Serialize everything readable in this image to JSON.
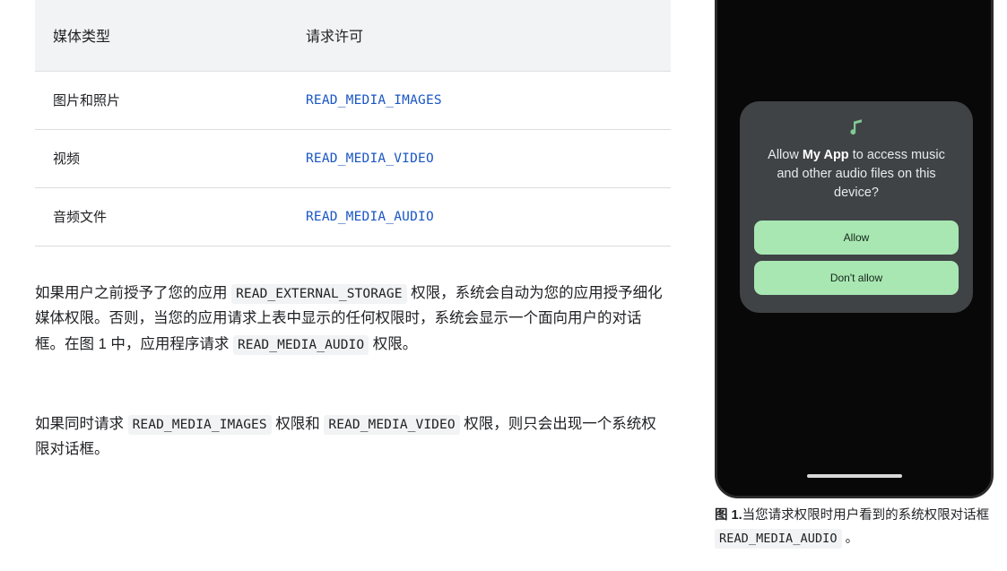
{
  "table": {
    "headers": [
      "媒体类型",
      "请求许可"
    ],
    "rows": [
      {
        "media_type": "图片和照片",
        "permission": "READ_MEDIA_IMAGES"
      },
      {
        "media_type": "视频",
        "permission": "READ_MEDIA_VIDEO"
      },
      {
        "media_type": "音频文件",
        "permission": "READ_MEDIA_AUDIO"
      }
    ]
  },
  "paragraphs": {
    "p1": {
      "seg1": "如果用户之前授予了您的应用 ",
      "code1": "READ_EXTERNAL_STORAGE",
      "seg2": " 权限，系统会自动为您的应用授予细化媒体权限。否则，当您的应用请求上表中显示的任何权限时，系统会显示一个面向用户的对话框。在图 1 中，应用程序请求 ",
      "code2": "READ_MEDIA_AUDIO",
      "seg3": " 权限。"
    },
    "p2": {
      "seg1": "如果同时请求 ",
      "code1": "READ_MEDIA_IMAGES",
      "seg2": " 权限和 ",
      "code2": "READ_MEDIA_VIDEO",
      "seg3": " 权限，则只会出现一个系统权限对话框。"
    }
  },
  "phone": {
    "dialog": {
      "icon": "music-note-icon",
      "title_before": "Allow ",
      "title_app": "My App",
      "title_after": " to access music and other audio files on this device?",
      "allow_label": "Allow",
      "deny_label": "Don't allow"
    }
  },
  "caption": {
    "figure_label": "图 1.",
    "text_before": "当您请求权限时用户看到的系统权限对话框 ",
    "code": "READ_MEDIA_AUDIO",
    "text_after": " 。"
  },
  "colors": {
    "link": "#1a56c4",
    "table_header_bg": "#f1f3f4",
    "chip_bg": "#f1f3f4",
    "dialog_bg": "#3f4346",
    "button_green": "#a9e7b2",
    "phone_bezel": "#2b2b2b",
    "icon_green": "#81c995"
  }
}
